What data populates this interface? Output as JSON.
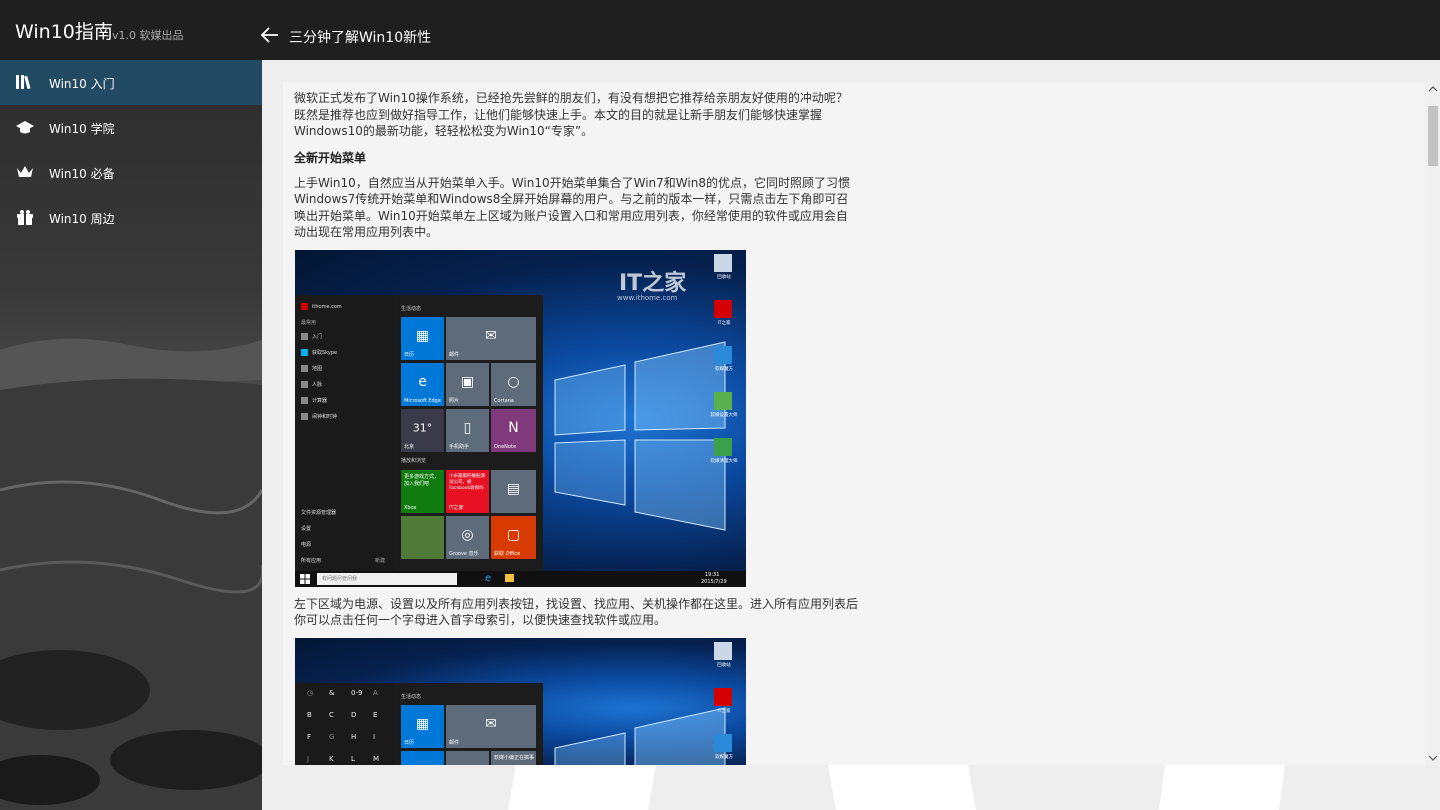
{
  "header": {
    "app_title": "Win10指南",
    "version": "v1.0 软媒出品",
    "page_title": "三分钟了解Win10新性"
  },
  "sidebar": {
    "items": [
      {
        "label": "Win10 入门",
        "icon": "books-icon",
        "active": true
      },
      {
        "label": "Win10 学院",
        "icon": "graduation-cap-icon",
        "active": false
      },
      {
        "label": "Win10 必备",
        "icon": "crown-icon",
        "active": false
      },
      {
        "label": "Win10 周边",
        "icon": "gift-icon",
        "active": false
      }
    ]
  },
  "article": {
    "intro": "微软正式发布了Win10操作系统，已经抢先尝鲜的朋友们，有没有想把它推荐给亲朋友好使用的冲动呢？既然是推荐也应到做好指导工作，让他们能够快速上手。本文的目的就是让新手朋友们能够快速掌握Windows10的最新功能，轻轻松松变为Win10“专家”。",
    "section1_title": "全新开始菜单",
    "section1_text": "上手Win10，自然应当从开始菜单入手。Win10开始菜单集合了Win7和Win8的优点，它同时照顾了习惯Windows7传统开始菜单和Windows8全屏开始屏幕的用户。与之前的版本一样，只需点击左下角即可召唤出开始菜单。Win10开始菜单左上区域为账户设置入口和常用应用列表，你经常使用的软件或应用会自动出现在常用应用列表中。",
    "section2_text": "左下区域为电源、设置以及所有应用列表按钮，找设置、找应用、关机操作都在这里。进入所有应用列表后你可以点击任何一个字母进入首字母索引，以便快速查找软件或应用。"
  },
  "screenshot1": {
    "watermark": "IT之家",
    "watermark_url": "www.ithome.com",
    "account": "ithome.com",
    "section_most_used": "最常用",
    "section_live": "生活动态",
    "section_play": "播放和浏览",
    "left_items": [
      "入门",
      "获取Skype",
      "地图",
      "人脉",
      "计算器",
      "闹钟和时钟"
    ],
    "bottom_items": [
      "文件资源管理器",
      "设置",
      "电源",
      "所有应用"
    ],
    "new_label": "新建",
    "tiles": [
      "日历",
      "邮件",
      "Microsoft Edge",
      "照片",
      "Cortana",
      "北京",
      "手机助手",
      "OneNote",
      "Xbox",
      "IT之家",
      "",
      "",
      "Groove 音乐",
      "获取 Office"
    ],
    "weather_temp": "31°",
    "weather_city": "北京",
    "xbox_text": "更多游戏方式，加入我们吧",
    "news_text": "小米旗舰的磁贴测试公司，被Facebook收购吗",
    "search_placeholder": "有问题尽管问我",
    "clock": "19:31",
    "date": "2015/7/29",
    "desktop_icons": [
      "回收站",
      "IT之家",
      "软媒魔方",
      "软媒设置大师",
      "软媒清理大师"
    ]
  },
  "screenshot2": {
    "section_live": "生活动态",
    "letter_grid": [
      "◷",
      "&",
      "0-9",
      "A",
      "B",
      "C",
      "D",
      "E",
      "F",
      "G",
      "H",
      "I",
      "J",
      "K",
      "L",
      "M"
    ],
    "tiles": [
      "日历",
      "邮件",
      "",
      "",
      "软媒小编正在搞事"
    ],
    "desktop_icons": [
      "回收站",
      "IT之家",
      "软媒魔方"
    ]
  },
  "colors": {
    "topbar": "#1f1f1f",
    "sidebar_active": "#234a63",
    "tile_blue": "#0078d7",
    "tile_gray": "#5d6b7a",
    "tile_purple": "#80397b",
    "tile_green": "#107c10",
    "tile_red": "#e81123",
    "tile_orange": "#d83b01"
  }
}
